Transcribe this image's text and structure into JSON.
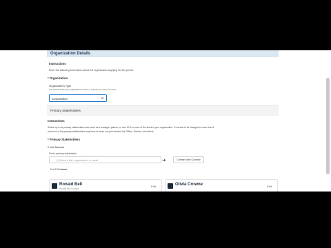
{
  "section": {
    "title": "Organization Details"
  },
  "instructions1": {
    "heading": "Instructions",
    "text": "Enter the following information about the organization applying for this permit."
  },
  "organization": {
    "heading": "* Organization",
    "type_label": "Organization Type",
    "type_help": "You cannot select any organizations unless a selection is made from here",
    "type_value": "Corporation"
  },
  "stakeholders_panel": {
    "title": "Primary Stakeholders"
  },
  "instructions2": {
    "heading": "Instructions",
    "line1": "Select up to six primary stakeholders who meet as a manager, partner, or own 10% or more of the stock in your organization. If it needs to be changed to more than 6",
    "line2": "and each of the primary stakeholders may have to those not yet included, the Officer, Director, and others."
  },
  "primary": {
    "heading": "* Primary Stakeholders",
    "count_label": "2 of 6 Selected",
    "search_label": "Find a primary stakeholder",
    "search_placeholder": "Q  Select a first, organization, or email",
    "create_button": "Create New Contact",
    "contacts_label": "2 of 2 Contacts"
  },
  "cards": [
    {
      "name": "Ronald Bell",
      "sub": "Ronald Bell Contact",
      "action": "Edit"
    },
    {
      "name": "Olivia Crowne",
      "sub": "",
      "action": "Edit"
    }
  ],
  "colors": {
    "accent": "#1a73c7",
    "header_bg": "#dbe7f1"
  }
}
